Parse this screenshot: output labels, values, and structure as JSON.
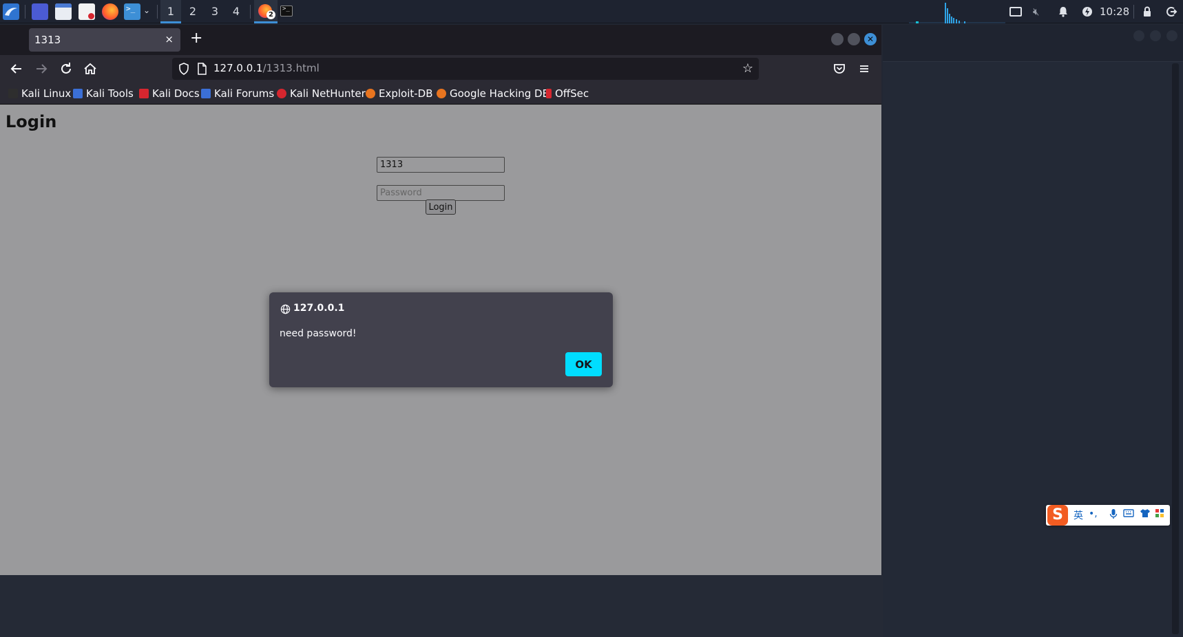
{
  "taskbar": {
    "workspaces": [
      "1",
      "2",
      "3",
      "4"
    ],
    "active_workspace": "1",
    "clock": "10:28",
    "firefox_badge": "2"
  },
  "browser": {
    "tab_title": "1313",
    "tab_close": "×",
    "new_tab": "+",
    "url_host": "127.0.0.1",
    "url_path": "/1313.html",
    "bookmarks": [
      {
        "label": "Kali Linux",
        "icon_color": "#2e2e2e"
      },
      {
        "label": "Kali Tools",
        "icon_color": "#3b6fd6"
      },
      {
        "label": "Kali Docs",
        "icon_color": "#d6262f"
      },
      {
        "label": "Kali Forums",
        "icon_color": "#3b6fd6"
      },
      {
        "label": "Kali NetHunter",
        "icon_color": "#d6262f"
      },
      {
        "label": "Exploit-DB",
        "icon_color": "#e8741f"
      },
      {
        "label": "Google Hacking DB",
        "icon_color": "#e8741f"
      },
      {
        "label": "OffSec",
        "icon_color": "#d6262f"
      }
    ]
  },
  "page": {
    "title": "Login",
    "username_value": "1313",
    "password_placeholder": "Password",
    "login_button": "Login"
  },
  "dialog": {
    "origin": "127.0.0.1",
    "message": "need password!",
    "ok_label": "OK"
  },
  "ime": {
    "logo": "S",
    "lang": "英",
    "punct": "•,"
  },
  "colors": {
    "accent": "#3d8fd6",
    "dialog_button": "#00ddff",
    "page_background": "#9a9a9c"
  }
}
